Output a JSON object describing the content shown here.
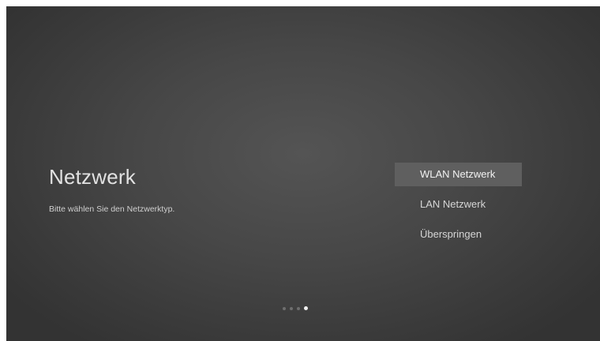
{
  "page": {
    "title": "Netzwerk",
    "subtitle": "Bitte wählen Sie den Netzwerktyp."
  },
  "menu": {
    "items": [
      {
        "label": "WLAN Netzwerk",
        "selected": true
      },
      {
        "label": "LAN Netzwerk",
        "selected": false
      },
      {
        "label": "Überspringen",
        "selected": false
      }
    ]
  },
  "pager": {
    "total_steps": 4,
    "current_step": 4
  },
  "colors": {
    "background": "#474747",
    "highlight": "#5f5f5f",
    "text": "#e2e2e2",
    "active_dot": "#f0f0f0",
    "inactive_dot": "#6e6e6e"
  }
}
